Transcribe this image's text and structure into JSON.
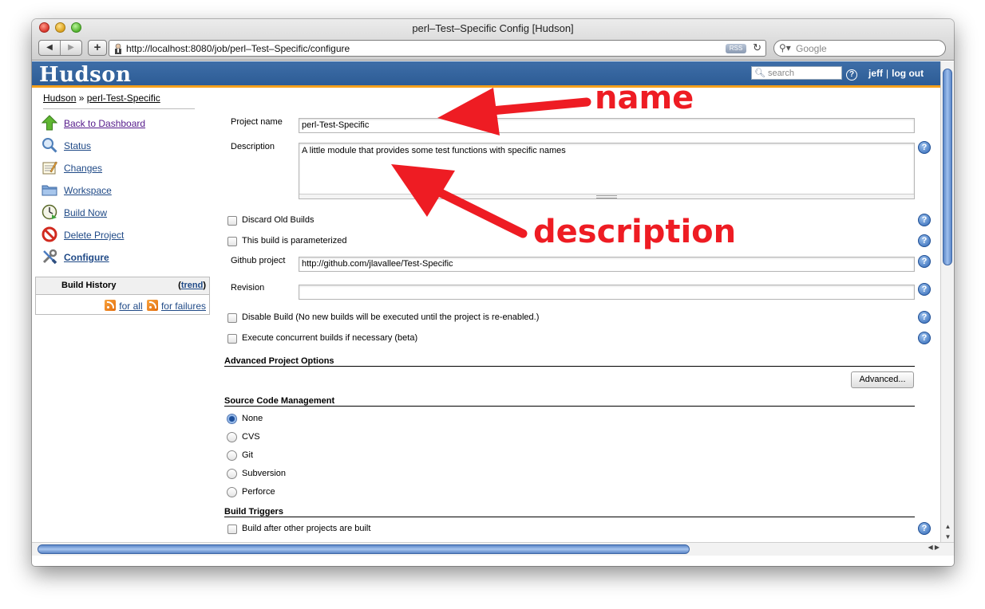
{
  "browser": {
    "window_title": "perl–Test–Specific Config [Hudson]",
    "url": "http://localhost:8080/job/perl–Test–Specific/configure",
    "rss_badge": "RSS",
    "search_placeholder": "Google"
  },
  "header": {
    "logo": "Hudson",
    "search_placeholder": "search",
    "help": "?",
    "user": "jeff",
    "separator": "|",
    "logout": "log out"
  },
  "breadcrumb": {
    "root": "Hudson",
    "separator": "»",
    "job": "perl-Test-Specific"
  },
  "sidebar": {
    "tasks": [
      {
        "label": "Back to Dashboard",
        "icon": "up-arrow-icon"
      },
      {
        "label": "Status",
        "icon": "magnifier-icon"
      },
      {
        "label": "Changes",
        "icon": "notepad-icon"
      },
      {
        "label": "Workspace",
        "icon": "folder-icon"
      },
      {
        "label": "Build Now",
        "icon": "clock-icon"
      },
      {
        "label": "Delete Project",
        "icon": "no-entry-icon"
      },
      {
        "label": "Configure",
        "icon": "wrench-screwdriver-icon"
      }
    ],
    "build_history": {
      "title": "Build History",
      "trend_open": "(",
      "trend": "trend",
      "trend_close": ")",
      "for_all": "for all",
      "for_failures": "for failures"
    }
  },
  "form": {
    "project_name_label": "Project name",
    "project_name_value": "perl-Test-Specific",
    "description_label": "Description",
    "description_value": "A little module that provides some test functions with specific names",
    "discard_old_builds": "Discard Old Builds",
    "parameterized": "This build is parameterized",
    "github_label": "Github project",
    "github_value": "http://github.com/jlavallee/Test-Specific",
    "revision_label": "Revision",
    "revision_value": "",
    "disable_build": "Disable Build (No new builds will be executed until the project is re-enabled.)",
    "concurrent": "Execute concurrent builds if necessary (beta)",
    "advanced_section": "Advanced Project Options",
    "advanced_button": "Advanced...",
    "scm_section": "Source Code Management",
    "scm_options": [
      "None",
      "CVS",
      "Git",
      "Subversion",
      "Perforce"
    ],
    "scm_selected": "None",
    "triggers_section": "Build Triggers",
    "build_after": "Build after other projects are built"
  },
  "annotations": {
    "name": "name",
    "description": "description",
    "color": "#ee1c23"
  },
  "colors": {
    "header_blue": "#2d5c95",
    "header_accent": "#f5a01a",
    "link": "#204a87"
  }
}
